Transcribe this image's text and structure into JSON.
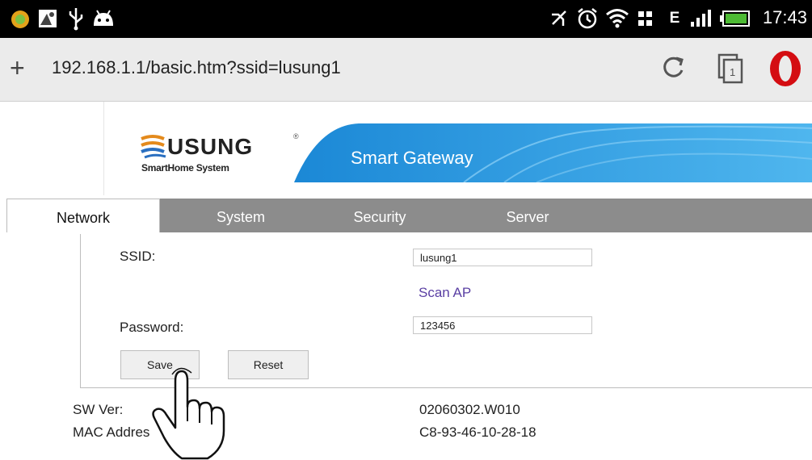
{
  "status_bar": {
    "time": "17:43",
    "icons": [
      "app-icon",
      "screenshot-icon",
      "usb-icon",
      "android-icon",
      "mute-icon",
      "alarm-icon",
      "wifi-icon",
      "network-icon",
      "edge-signal-icon",
      "signal-icon",
      "battery-icon"
    ],
    "edge_label": "E"
  },
  "address_bar": {
    "url": "192.168.1.1/basic.htm?ssid=lusung1",
    "tab_count": "1"
  },
  "banner": {
    "brand": "USUNG",
    "reg_mark": "®",
    "subtitle": "SmartHome System",
    "title": "Smart Gateway"
  },
  "nav": {
    "tabs": [
      {
        "label": "Network",
        "active": true
      },
      {
        "label": "System",
        "active": false
      },
      {
        "label": "Security",
        "active": false
      },
      {
        "label": "Server",
        "active": false
      }
    ]
  },
  "form": {
    "ssid_label": "SSID:",
    "ssid_value": "lusung1",
    "scan_label": "Scan AP",
    "password_label": "Password:",
    "password_value": "123456",
    "save_label": "Save",
    "reset_label": "Reset"
  },
  "info": {
    "sw_label": "SW Ver:",
    "sw_value": "02060302.W010",
    "mac_label": "MAC Addres",
    "mac_value": "C8-93-46-10-28-18"
  },
  "colors": {
    "status_bar": "#000000",
    "address_bar": "#ebebeb",
    "nav_bar": "#8c8c8c",
    "banner_blue": "#1f8fd8",
    "link": "#5a3fa3",
    "opera_red": "#d40d12"
  }
}
